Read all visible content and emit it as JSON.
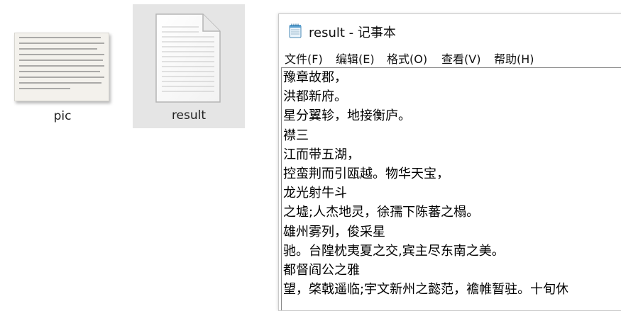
{
  "desktop": {
    "icons": [
      {
        "label": "pic"
      },
      {
        "label": "result"
      }
    ]
  },
  "notepad": {
    "title": "result - 记事本",
    "menu": [
      "文件(F)",
      "编辑(E)",
      "格式(O)",
      "查看(V)",
      "帮助(H)"
    ],
    "lines": [
      "豫章故郡，",
      "洪都新府。",
      "星分翼轸，地接衡庐。",
      "襟三",
      "江而带五湖，",
      "控蛮荆而引瓯越。物华天宝，",
      "龙光射牛斗",
      "之墟;人杰地灵，徐孺下陈蕃之榻。",
      "雄州雾列，俊采星",
      "驰。台隍枕夷夏之交,宾主尽东南之美。",
      "都督阎公之雅",
      "望，棨戟遥临;宇文新州之懿范，襜帷暂驻。十旬休"
    ]
  },
  "colors": {
    "selected_icon_bg": "#e5e5e5",
    "window_border": "#c9c9c9"
  }
}
